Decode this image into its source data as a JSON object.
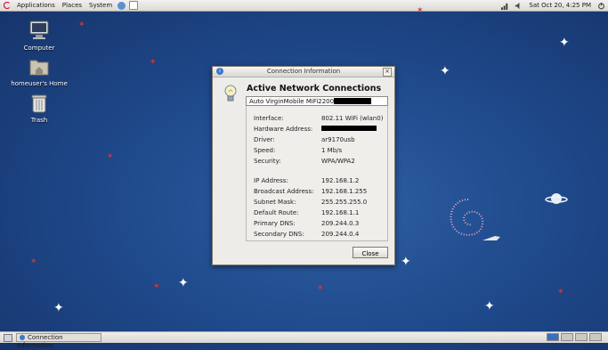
{
  "top_panel": {
    "menus": [
      "Applications",
      "Places",
      "System"
    ],
    "clock": "Sat Oct 20,  4:25 PM"
  },
  "desktop": {
    "icons": [
      {
        "label": "Computer",
        "icon": "computer-icon"
      },
      {
        "label": "homeuser's Home",
        "icon": "home-folder-icon"
      },
      {
        "label": "Trash",
        "icon": "trash-icon"
      }
    ]
  },
  "dialog": {
    "title": "Connection Information",
    "heading": "Active Network Connections",
    "connection_tab": "Auto VirginMobile MiFi2200",
    "fields": [
      {
        "label": "Interface:",
        "value": "802.11 WiFi (wlan0)"
      },
      {
        "label": "Hardware Address:",
        "value": ""
      },
      {
        "label": "Driver:",
        "value": "ar9170usb"
      },
      {
        "label": "Speed:",
        "value": "1 Mb/s"
      },
      {
        "label": "Security:",
        "value": "WPA/WPA2"
      },
      {
        "label": "IP Address:",
        "value": "192.168.1.2"
      },
      {
        "label": "Broadcast Address:",
        "value": "192.168.1.255"
      },
      {
        "label": "Subnet Mask:",
        "value": "255.255.255.0"
      },
      {
        "label": "Default Route:",
        "value": "192.168.1.1"
      },
      {
        "label": "Primary DNS:",
        "value": "209.244.0.3"
      },
      {
        "label": "Secondary DNS:",
        "value": "209.244.0.4"
      }
    ],
    "close_label": "Close"
  },
  "bottom_panel": {
    "task_label": "Connection Information"
  },
  "colors": {
    "desktop_bg": "#1f4a8c",
    "dialog_bg": "#edece8",
    "accent": "#3d78c6"
  }
}
